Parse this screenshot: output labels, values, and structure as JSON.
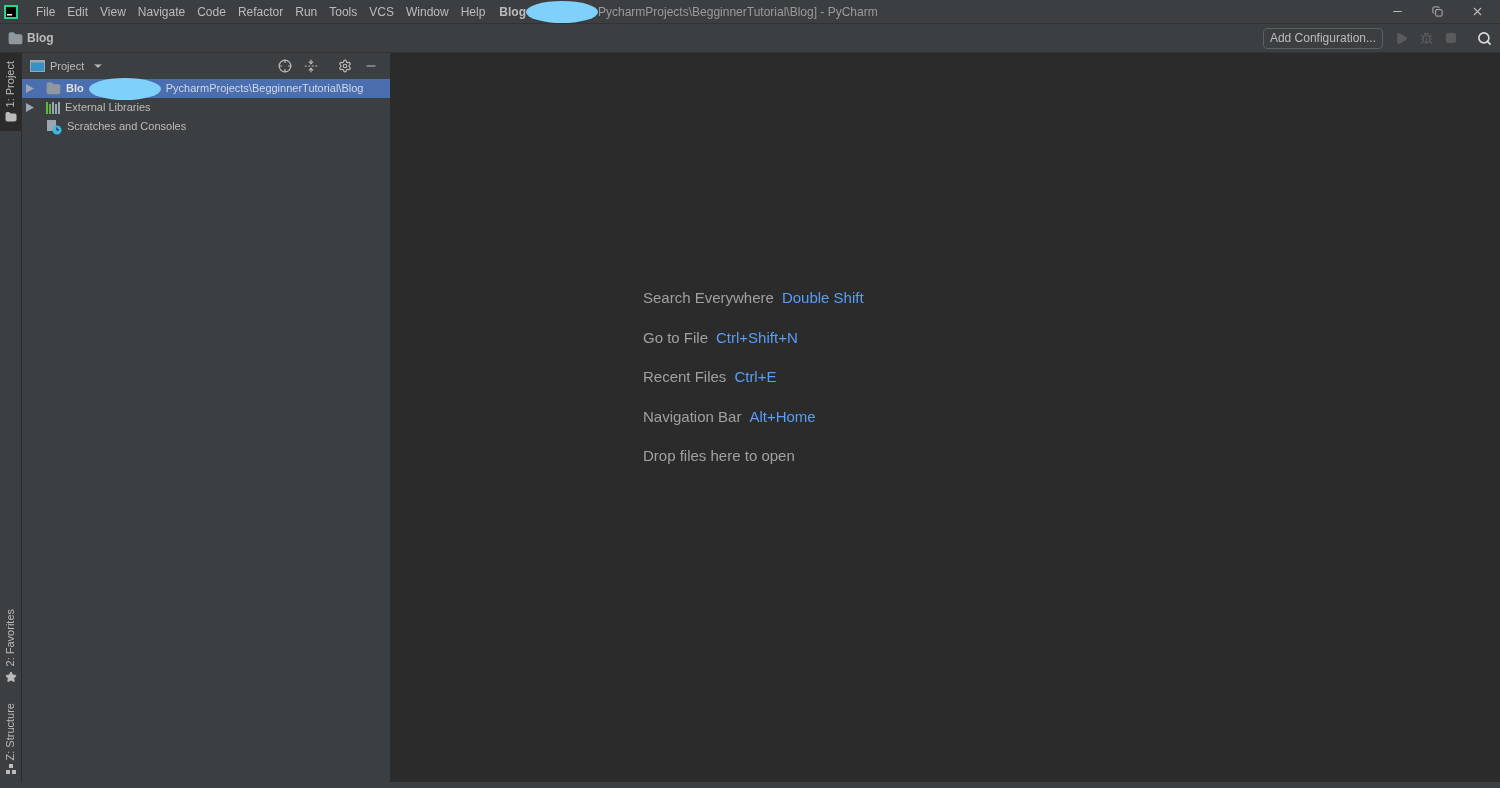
{
  "menu": [
    "File",
    "Edit",
    "View",
    "Navigate",
    "Code",
    "Refactor",
    "Run",
    "Tools",
    "VCS",
    "Window",
    "Help"
  ],
  "window": {
    "title_project": "Blog",
    "title_rest": "PycharmProjects\\BegginnerTutorial\\Blog] - PyCharm"
  },
  "breadcrumb": "Blog",
  "toolbar": {
    "config_button": "Add Configuration..."
  },
  "side_tabs": [
    {
      "label": "1: Project",
      "kind": "folder",
      "selected": true
    },
    {
      "label": "2: Favorites",
      "kind": "star",
      "selected": false
    },
    {
      "label": "Z: Structure",
      "kind": "structure",
      "selected": false
    }
  ],
  "project_panel": {
    "title": "Project",
    "tree": [
      {
        "kind": "folder",
        "name": "Blo",
        "path": "PycharmProjects\\BegginnerTutorial\\Blog",
        "expanded": false,
        "selected": true
      },
      {
        "kind": "library",
        "name": "External Libraries",
        "expanded": false,
        "selected": false
      },
      {
        "kind": "scratches",
        "name": "Scratches and Consoles",
        "selected": false
      }
    ]
  },
  "hints": [
    {
      "label": "Search Everywhere",
      "shortcut": "Double Shift"
    },
    {
      "label": "Go to File",
      "shortcut": "Ctrl+Shift+N"
    },
    {
      "label": "Recent Files",
      "shortcut": "Ctrl+E"
    },
    {
      "label": "Navigation Bar",
      "shortcut": "Alt+Home"
    },
    {
      "label": "Drop files here to open"
    }
  ]
}
